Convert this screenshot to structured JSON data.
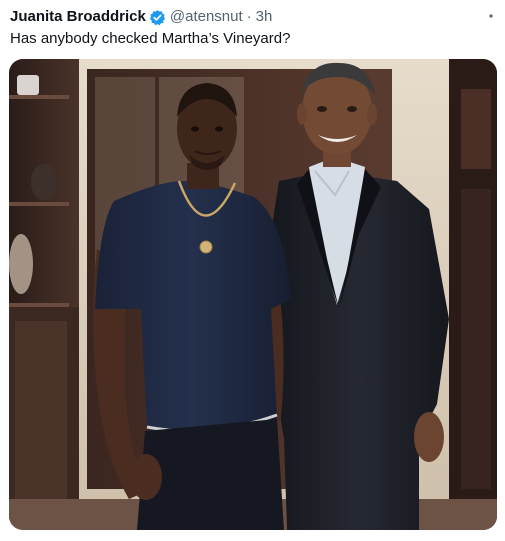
{
  "tweet": {
    "display_name": "Juanita Broaddrick",
    "handle": "@atensnut",
    "separator": "·",
    "timestamp": "3h",
    "text": "Has anybody checked Martha’s Vineyard?"
  },
  "icons": {
    "verified": "verified-badge-icon",
    "more": "more-options-icon"
  },
  "colors": {
    "verified_blue": "#1d9bf0",
    "secondary_text": "#536471",
    "primary_text": "#0f1419"
  }
}
